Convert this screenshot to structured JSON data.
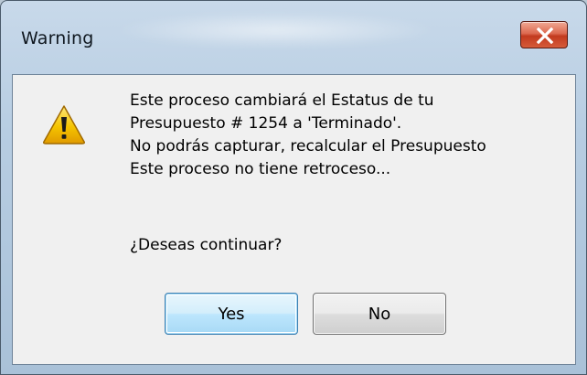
{
  "window": {
    "title": "Warning"
  },
  "message": {
    "lines": [
      "Este proceso cambiará el Estatus de tu",
      "Presupuesto # 1254 a 'Terminado'.",
      "No podrás capturar, recalcular el Presupuesto",
      "Este proceso no tiene retroceso..."
    ],
    "question": "¿Deseas continuar?"
  },
  "buttons": {
    "yes_label": "Yes",
    "no_label": "No"
  },
  "icons": {
    "dialog_icon": "warning-icon",
    "close": "close-icon"
  },
  "colors": {
    "titlebar": "#b7cde2",
    "client_bg": "#f0f0f0",
    "close_button": "#c23a1e",
    "default_button_border": "#3c7fb1",
    "warning_fill": "#f5c400"
  }
}
